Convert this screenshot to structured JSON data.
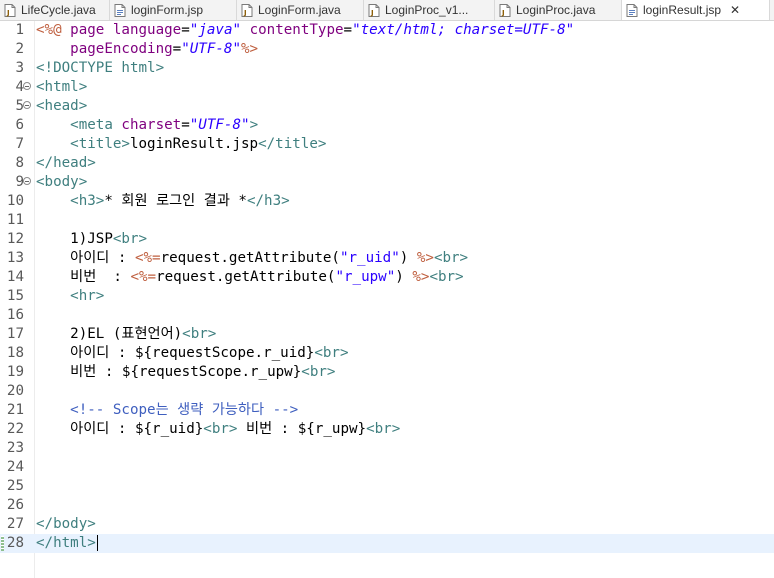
{
  "tabs": [
    {
      "label": "LifeCycle.java",
      "icon": "java-file-icon",
      "active": false
    },
    {
      "label": "loginForm.jsp",
      "icon": "jsp-file-icon",
      "active": false
    },
    {
      "label": "LoginForm.java",
      "icon": "java-file-icon",
      "active": false
    },
    {
      "label": "LoginProc_v1...",
      "icon": "java-file-icon",
      "active": false
    },
    {
      "label": "LoginProc.java",
      "icon": "java-file-icon",
      "active": false
    },
    {
      "label": "loginResult.jsp",
      "icon": "jsp-file-icon",
      "active": true,
      "close": "✕"
    }
  ],
  "editor": {
    "current_line": 28,
    "lines": [
      {
        "n": "1",
        "tokens": [
          [
            "jsp",
            "<%@ "
          ],
          [
            "attr",
            "page "
          ],
          [
            "attr",
            "language"
          ],
          [
            "plain",
            "="
          ],
          [
            "str",
            "\"java\""
          ],
          [
            "plain",
            " "
          ],
          [
            "attr",
            "contentType"
          ],
          [
            "plain",
            "="
          ],
          [
            "str",
            "\"text/html; charset=UTF-8\""
          ]
        ]
      },
      {
        "n": "2",
        "tokens": [
          [
            "plain",
            "    "
          ],
          [
            "attr",
            "pageEncoding"
          ],
          [
            "plain",
            "="
          ],
          [
            "str",
            "\"UTF-8\""
          ],
          [
            "jsp",
            "%>"
          ]
        ]
      },
      {
        "n": "3",
        "tokens": [
          [
            "tag",
            "<!DOCTYPE html>"
          ]
        ]
      },
      {
        "n": "4",
        "fold": true,
        "tokens": [
          [
            "tag",
            "<html>"
          ]
        ]
      },
      {
        "n": "5",
        "fold": true,
        "tokens": [
          [
            "tag",
            "<head>"
          ]
        ]
      },
      {
        "n": "6",
        "tokens": [
          [
            "plain",
            "    "
          ],
          [
            "tag",
            "<meta "
          ],
          [
            "attr",
            "charset"
          ],
          [
            "plain",
            "="
          ],
          [
            "str",
            "\"UTF-8\""
          ],
          [
            "tag",
            ">"
          ]
        ]
      },
      {
        "n": "7",
        "tokens": [
          [
            "plain",
            "    "
          ],
          [
            "tag",
            "<title>"
          ],
          [
            "plain",
            "loginResult.jsp"
          ],
          [
            "tag",
            "</title>"
          ]
        ]
      },
      {
        "n": "8",
        "tokens": [
          [
            "tag",
            "</head>"
          ]
        ]
      },
      {
        "n": "9",
        "fold": true,
        "tokens": [
          [
            "tag",
            "<body>"
          ]
        ]
      },
      {
        "n": "10",
        "tokens": [
          [
            "plain",
            "    "
          ],
          [
            "tag",
            "<h3>"
          ],
          [
            "plain",
            "* 회원 로그인 결과 *"
          ],
          [
            "tag",
            "</h3>"
          ]
        ]
      },
      {
        "n": "11",
        "tokens": []
      },
      {
        "n": "12",
        "tokens": [
          [
            "plain",
            "    1)JSP"
          ],
          [
            "tag",
            "<br>"
          ]
        ]
      },
      {
        "n": "13",
        "tokens": [
          [
            "plain",
            "    아이디 : "
          ],
          [
            "jsp",
            "<%="
          ],
          [
            "plain",
            "request.getAttribute("
          ],
          [
            "dstr",
            "\"r_uid\""
          ],
          [
            "plain",
            ") "
          ],
          [
            "jsp",
            "%>"
          ],
          [
            "tag",
            "<br>"
          ]
        ]
      },
      {
        "n": "14",
        "tokens": [
          [
            "plain",
            "    비번  : "
          ],
          [
            "jsp",
            "<%="
          ],
          [
            "plain",
            "request.getAttribute("
          ],
          [
            "dstr",
            "\"r_upw\""
          ],
          [
            "plain",
            ") "
          ],
          [
            "jsp",
            "%>"
          ],
          [
            "tag",
            "<br>"
          ]
        ]
      },
      {
        "n": "15",
        "tokens": [
          [
            "plain",
            "    "
          ],
          [
            "tag",
            "<hr>"
          ]
        ]
      },
      {
        "n": "16",
        "tokens": []
      },
      {
        "n": "17",
        "tokens": [
          [
            "plain",
            "    2)EL (표현언어)"
          ],
          [
            "tag",
            "<br>"
          ]
        ]
      },
      {
        "n": "18",
        "tokens": [
          [
            "plain",
            "    아이디 : ${requestScope.r_uid}"
          ],
          [
            "tag",
            "<br>"
          ]
        ]
      },
      {
        "n": "19",
        "tokens": [
          [
            "plain",
            "    비번 : ${requestScope.r_upw}"
          ],
          [
            "tag",
            "<br>"
          ]
        ]
      },
      {
        "n": "20",
        "tokens": []
      },
      {
        "n": "21",
        "tokens": [
          [
            "plain",
            "    "
          ],
          [
            "comment",
            "<!-- Scope는 생략 가능하다 -->"
          ]
        ]
      },
      {
        "n": "22",
        "tokens": [
          [
            "plain",
            "    아이디 : ${r_uid}"
          ],
          [
            "tag",
            "<br>"
          ],
          [
            "plain",
            " 비번 : ${r_upw}"
          ],
          [
            "tag",
            "<br>"
          ]
        ]
      },
      {
        "n": "23",
        "tokens": []
      },
      {
        "n": "24",
        "tokens": []
      },
      {
        "n": "25",
        "tokens": []
      },
      {
        "n": "26",
        "tokens": []
      },
      {
        "n": "27",
        "tokens": [
          [
            "tag",
            "</body>"
          ]
        ]
      },
      {
        "n": "28",
        "tokens": [
          [
            "tag",
            "</html>"
          ]
        ],
        "cursor": true
      }
    ]
  }
}
